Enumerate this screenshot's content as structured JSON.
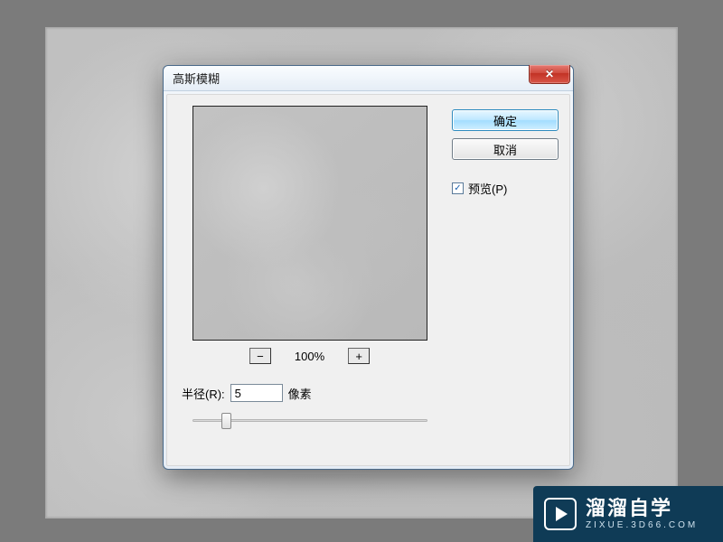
{
  "dialog": {
    "title": "高斯模糊",
    "close_glyph": "✕",
    "ok_label": "确定",
    "cancel_label": "取消",
    "preview_label": "预览(P)",
    "zoom_minus": "−",
    "zoom_plus": "+",
    "zoom_level": "100%",
    "radius_label": "半径(R):",
    "radius_value": "5",
    "radius_unit": "像素"
  },
  "watermark": {
    "brand": "溜溜自学",
    "url": "ZIXUE.3D66.COM"
  }
}
